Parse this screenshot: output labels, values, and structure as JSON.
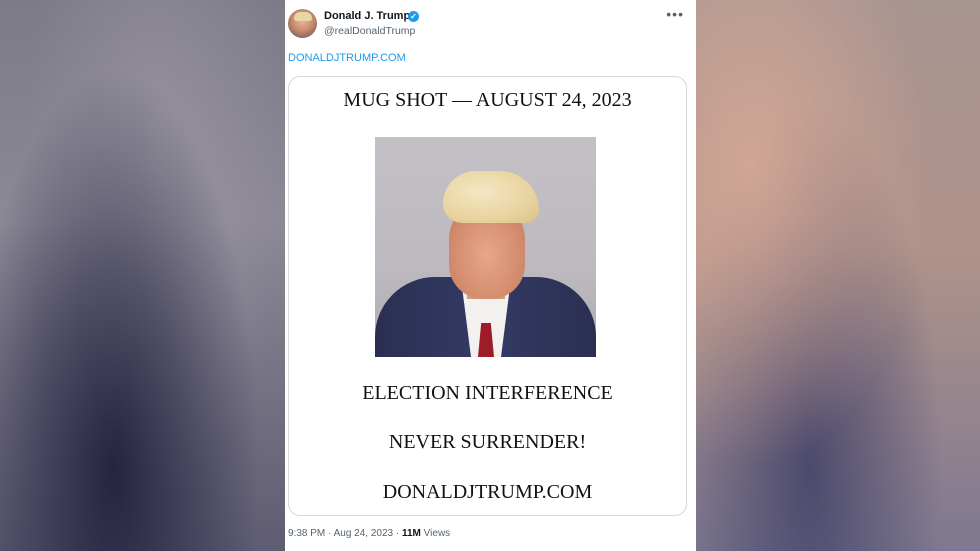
{
  "tweet": {
    "display_name": "Donald J. Trump",
    "handle": "@realDonaldTrump",
    "more_icon": "•••",
    "link_text": "DONALDJTRUMP.COM",
    "media": {
      "line1": "MUG SHOT — AUGUST 24, 2023",
      "line2": "ELECTION INTERFERENCE",
      "line3": "NEVER SURRENDER!",
      "line4": "DONALDJTRUMP.COM"
    },
    "time": "9:38 PM",
    "date": "Aug 24, 2023",
    "views_count": "11M",
    "views_label": "Views"
  },
  "colors": {
    "link": "#1d9bf0",
    "verified": "#1d9bf0",
    "secondary_text": "#536471"
  },
  "icons": [
    "verified-badge-icon",
    "more-options-icon"
  ]
}
